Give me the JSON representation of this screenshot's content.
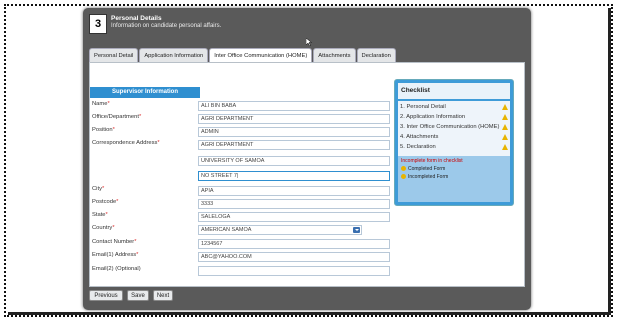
{
  "header": {
    "step_number": "3",
    "title": "Personal Details",
    "subtitle": "Information on candidate personal affairs."
  },
  "tabs": [
    {
      "label": "Personal Detail",
      "active": false
    },
    {
      "label": "Application Information",
      "active": false
    },
    {
      "label": "Inter Office Communication (HOME)",
      "active": true
    },
    {
      "label": "Attachments",
      "active": false
    },
    {
      "label": "Declaration",
      "active": false
    }
  ],
  "section": {
    "title": "Supervisor Information"
  },
  "form": {
    "name": {
      "label": "Name",
      "value": "ALI BIN BABA"
    },
    "office": {
      "label": "Office/Department",
      "value": "AGRI DEPARTMENT"
    },
    "position": {
      "label": "Position",
      "value": "ADMIN"
    },
    "address": {
      "label": "Correspondence Address",
      "line1": "AGRI DEPARTMENT",
      "line2": "UNIVERSITY OF SAMOA",
      "line3": "NO STREET 7|"
    },
    "city": {
      "label": "City",
      "value": "APIA"
    },
    "postcode": {
      "label": "Postcode",
      "value": "3333"
    },
    "state": {
      "label": "State",
      "value": "SALELOGA"
    },
    "country": {
      "label": "Country",
      "value": "AMERICAN SAMOA"
    },
    "contact": {
      "label": "Contact Number",
      "value": "1234567"
    },
    "email1": {
      "label": "Email(1) Address",
      "value": "ABC@YAHOO.COM"
    },
    "email2": {
      "label": "Email(2) (Optional)",
      "value": ""
    }
  },
  "checklist": {
    "title": "Checklist",
    "items": [
      "1. Personal Detail",
      "2. Application Information",
      "3. Inter Office Communication (HOME)",
      "4. Attachments",
      "5. Declaration"
    ],
    "note": "Incomplete form in checklist",
    "legend_complete": "Completed Form",
    "legend_incomplete": "Incompleted Form"
  },
  "buttons": {
    "previous": "Previous",
    "save": "Save",
    "next": "Next"
  },
  "colors": {
    "accent": "#2f8fd0",
    "window_bg": "#5a5a5a",
    "warn": "#e8b400",
    "required": "#d33333"
  }
}
